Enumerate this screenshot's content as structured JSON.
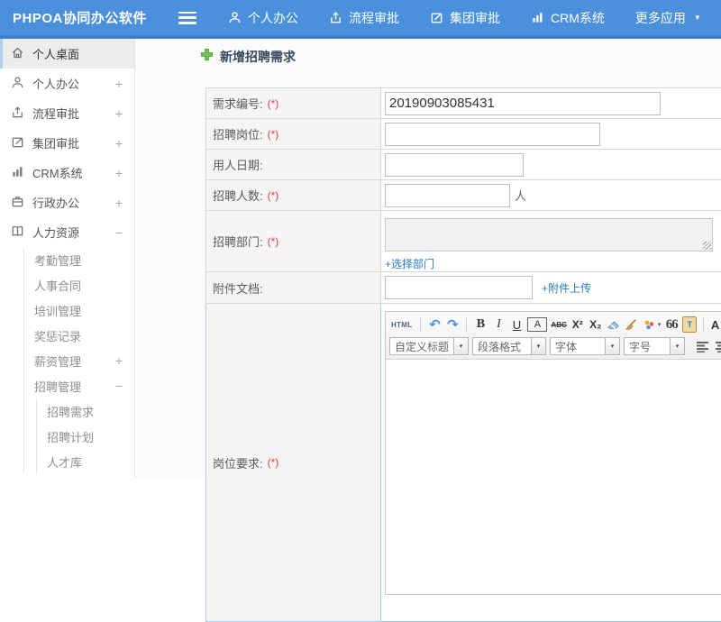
{
  "colors": {
    "header_blue": "#4a90dc",
    "header_blue_dark": "#3b7ec9",
    "link_blue": "#2a7cc9",
    "required_red": "#e03c3c",
    "sidebar_active_border": "#aed0f0",
    "title_green_icon": "#72c24e"
  },
  "icons": {
    "caret_down": "▼",
    "select_caret": "▾",
    "undo": "↶",
    "redo": "↷"
  },
  "header": {
    "logo": "PHPOA协同办公软件",
    "nav": [
      {
        "label": "个人办公",
        "icon": "person-icon"
      },
      {
        "label": "流程审批",
        "icon": "workflow-icon"
      },
      {
        "label": "集团审批",
        "icon": "edit-icon"
      },
      {
        "label": "CRM系统",
        "icon": "bar-chart-icon"
      },
      {
        "label": "更多应用",
        "icon": "caret-down-icon"
      }
    ]
  },
  "sidebar": {
    "items": [
      {
        "label": "个人桌面",
        "icon": "home-icon",
        "active": true,
        "expand": ""
      },
      {
        "label": "个人办公",
        "icon": "person-icon",
        "expand": "+"
      },
      {
        "label": "流程审批",
        "icon": "workflow-icon",
        "expand": "+"
      },
      {
        "label": "集团审批",
        "icon": "edit-icon",
        "expand": "+"
      },
      {
        "label": "CRM系统",
        "icon": "bar-chart-icon",
        "expand": "+"
      },
      {
        "label": "行政办公",
        "icon": "briefcase-icon",
        "expand": "+"
      },
      {
        "label": "人力资源",
        "icon": "book-icon",
        "expand": "−"
      }
    ],
    "hr_children": [
      {
        "label": "考勤管理",
        "expand": ""
      },
      {
        "label": "人事合同",
        "expand": ""
      },
      {
        "label": "培训管理",
        "expand": ""
      },
      {
        "label": "奖惩记录",
        "expand": ""
      },
      {
        "label": "薪资管理",
        "expand": "+"
      },
      {
        "label": "招聘管理",
        "expand": "−"
      }
    ],
    "recruit_children": [
      {
        "label": "招聘需求"
      },
      {
        "label": "招聘计划"
      },
      {
        "label": "人才库"
      }
    ]
  },
  "main": {
    "title": "新增招聘需求",
    "form": {
      "req_label": "需求编号:",
      "req_star": "(*)",
      "req_value": "20190903085431",
      "post_label": "招聘岗位:",
      "post_star": "(*)",
      "date_label": "用人日期:",
      "count_label": "招聘人数:",
      "count_star": "(*)",
      "count_suffix": "人",
      "dept_label": "招聘部门:",
      "dept_star": "(*)",
      "dept_link": "+选择部门",
      "file_label": "附件文档:",
      "file_link": "+附件上传",
      "duty_label": "岗位要求:",
      "duty_star": "(*)"
    },
    "editor": {
      "html_btn": "HTML",
      "bold": "B",
      "italic": "I",
      "underline": "U",
      "border_a": "A",
      "strike": "ABC",
      "sup": "X²",
      "sub": "X₂",
      "quote": "66",
      "paste_t": "T",
      "fontcolor": "A",
      "dd_title": "自定义标题",
      "dd_para": "段落格式",
      "dd_font": "字体",
      "dd_size": "字号"
    }
  }
}
